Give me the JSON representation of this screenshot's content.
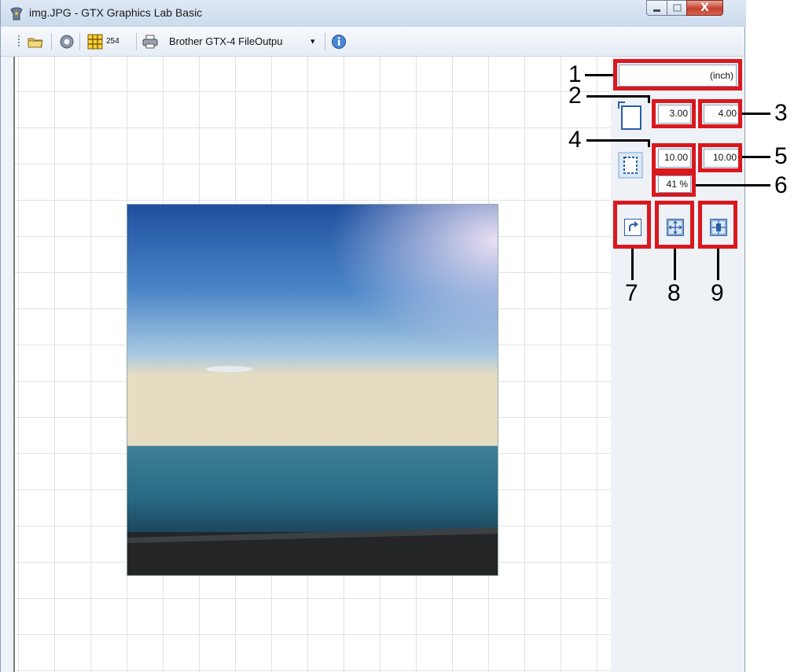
{
  "window": {
    "title": "img.JPG - GTX Graphics Lab Basic",
    "close_symbol": "X"
  },
  "toolbar": {
    "resolution_label": "254",
    "printer_select": "Brother GTX-4 FileOutpu",
    "dropdown_arrow": "▾"
  },
  "panel": {
    "unit_label": "(inch)",
    "platen_width": "3.00",
    "platen_height": "4.00",
    "image_width": "10.00",
    "image_height": "10.00",
    "scale_percent": "41 %"
  },
  "callouts": [
    "1",
    "2",
    "3",
    "4",
    "5",
    "6",
    "7",
    "8",
    "9"
  ],
  "icons": {
    "open": "folder-icon",
    "settings": "gear-icon",
    "grid": "grid-icon",
    "printer": "printer-icon",
    "info": "info-icon",
    "platen": "platen-size-icon",
    "image_size": "image-size-icon",
    "rotate": "rotate-icon",
    "fit": "fit-to-platen-icon",
    "center": "center-icon"
  },
  "colors": {
    "callout_red": "#d9181e",
    "icon_blue": "#2a5fa8"
  }
}
